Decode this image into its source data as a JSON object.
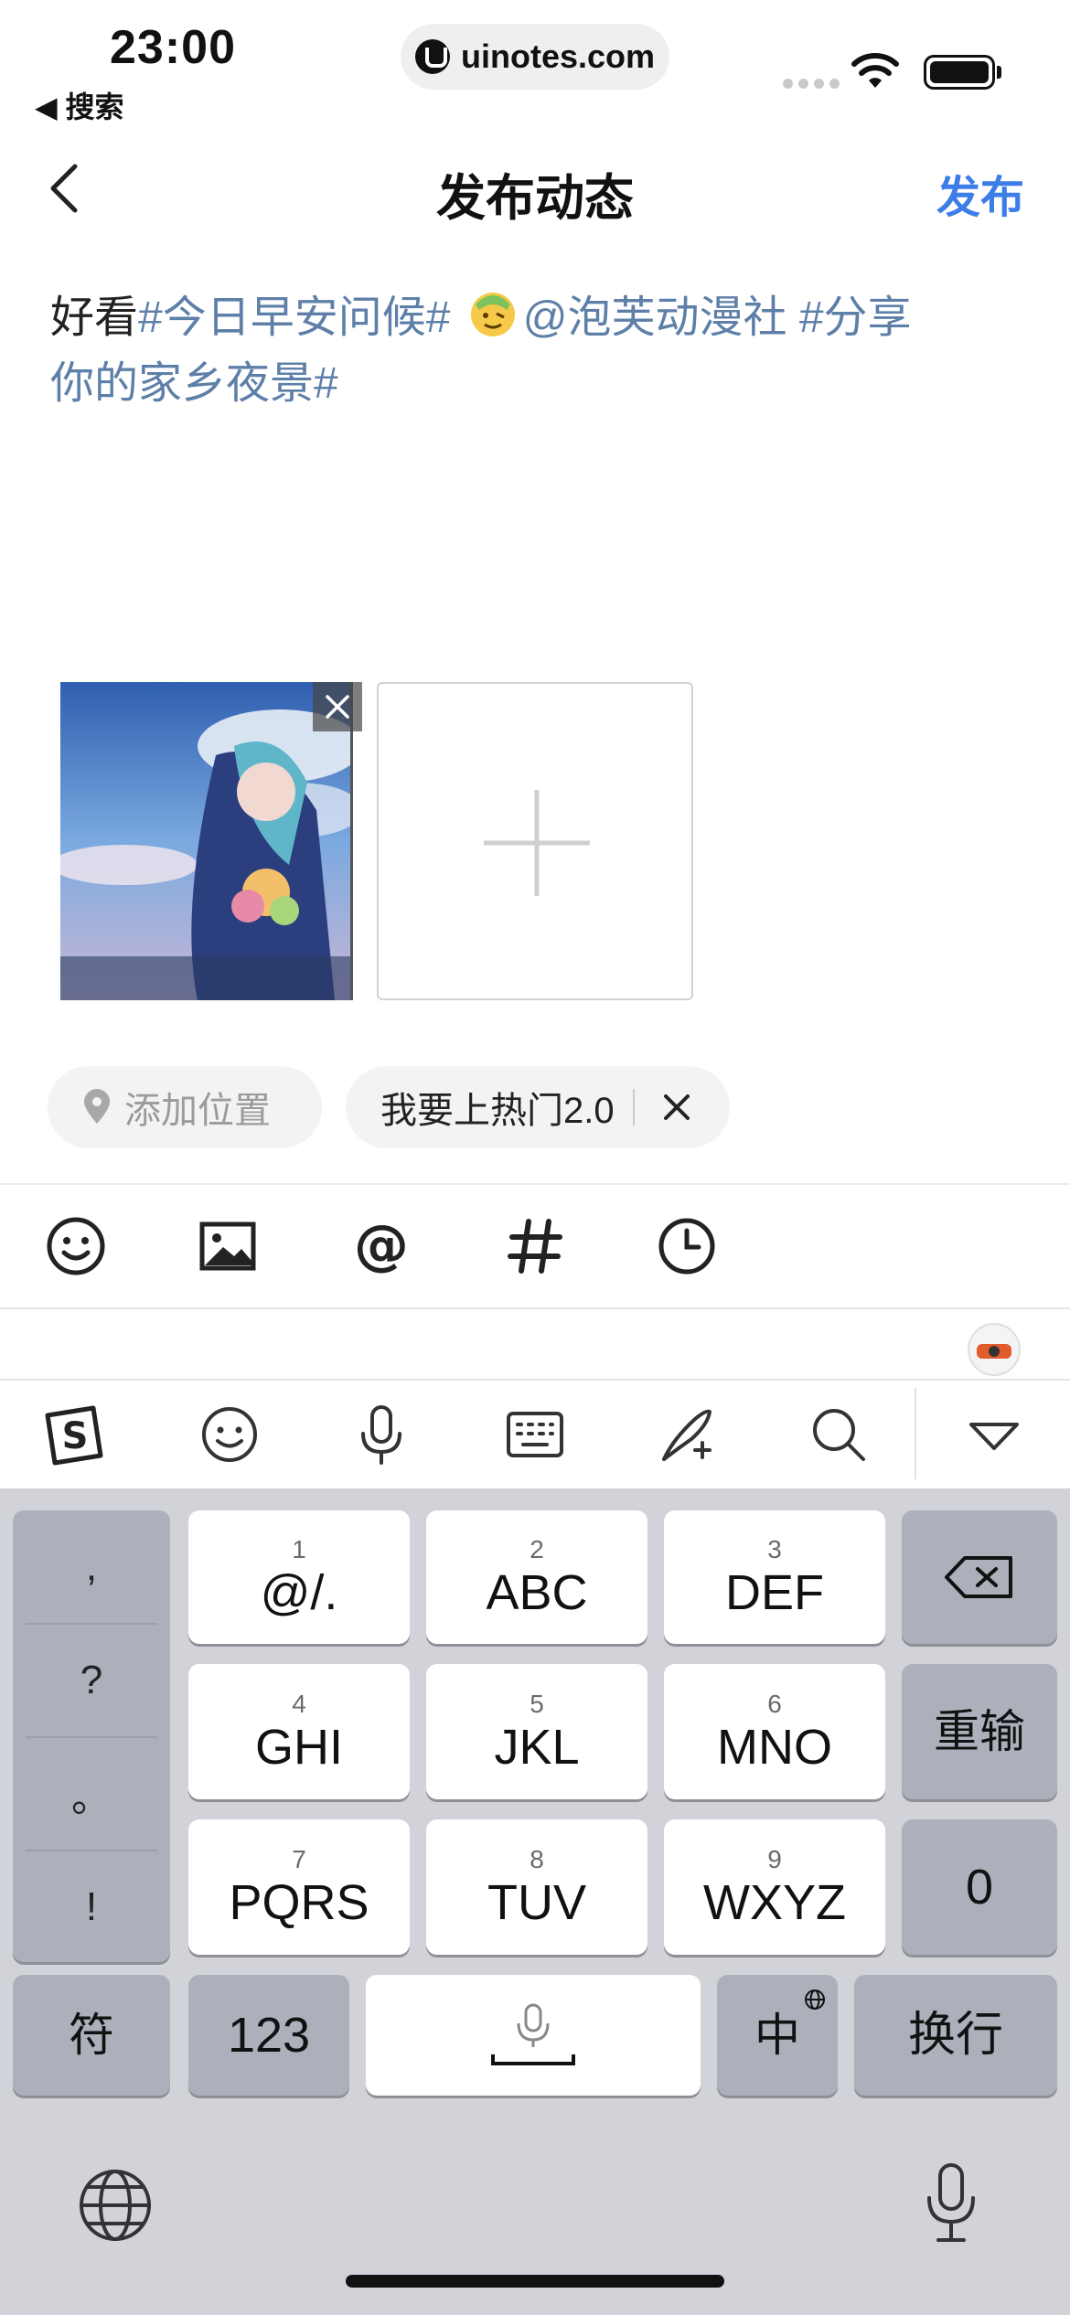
{
  "status_bar": {
    "time": "23:00",
    "back_app": "◀ 搜索",
    "url": "uinotes.com"
  },
  "nav": {
    "title": "发布动态",
    "publish": "发布"
  },
  "post": {
    "text_plain_1": "好看",
    "tag_1": "#今日早安问候#",
    "mention": "@泡芙动漫社",
    "tag_2_part1": "#分享",
    "tag_2_part2": "你的家乡夜景#"
  },
  "chips": {
    "location": "添加位置",
    "topic": "我要上热门2.0"
  },
  "toolbar": {
    "icons": [
      "emoji-icon",
      "image-icon",
      "at-icon",
      "hashtag-icon",
      "clock-icon"
    ]
  },
  "ime_toolbar": {
    "icons": [
      "sogou-logo-icon",
      "emoji-face-icon",
      "microphone-icon",
      "keyboard-icon",
      "handwriting-icon",
      "search-icon",
      "collapse-icon"
    ]
  },
  "keyboard": {
    "punct": [
      ",",
      "?",
      "。",
      "!"
    ],
    "keys": [
      {
        "num": "1",
        "label": "@/."
      },
      {
        "num": "2",
        "label": "ABC"
      },
      {
        "num": "3",
        "label": "DEF"
      },
      {
        "num": "4",
        "label": "GHI"
      },
      {
        "num": "5",
        "label": "JKL"
      },
      {
        "num": "6",
        "label": "MNO"
      },
      {
        "num": "7",
        "label": "PQRS"
      },
      {
        "num": "8",
        "label": "TUV"
      },
      {
        "num": "9",
        "label": "WXYZ"
      }
    ],
    "reinput": "重输",
    "zero": "0",
    "symbols": "符",
    "numeric": "123",
    "lang": "中",
    "enter": "换行"
  },
  "colors": {
    "accent": "#3d7de8",
    "tag": "#5d7fa8",
    "keyboard_bg": "#d1d3d9",
    "key_dark": "#abb0ba"
  }
}
